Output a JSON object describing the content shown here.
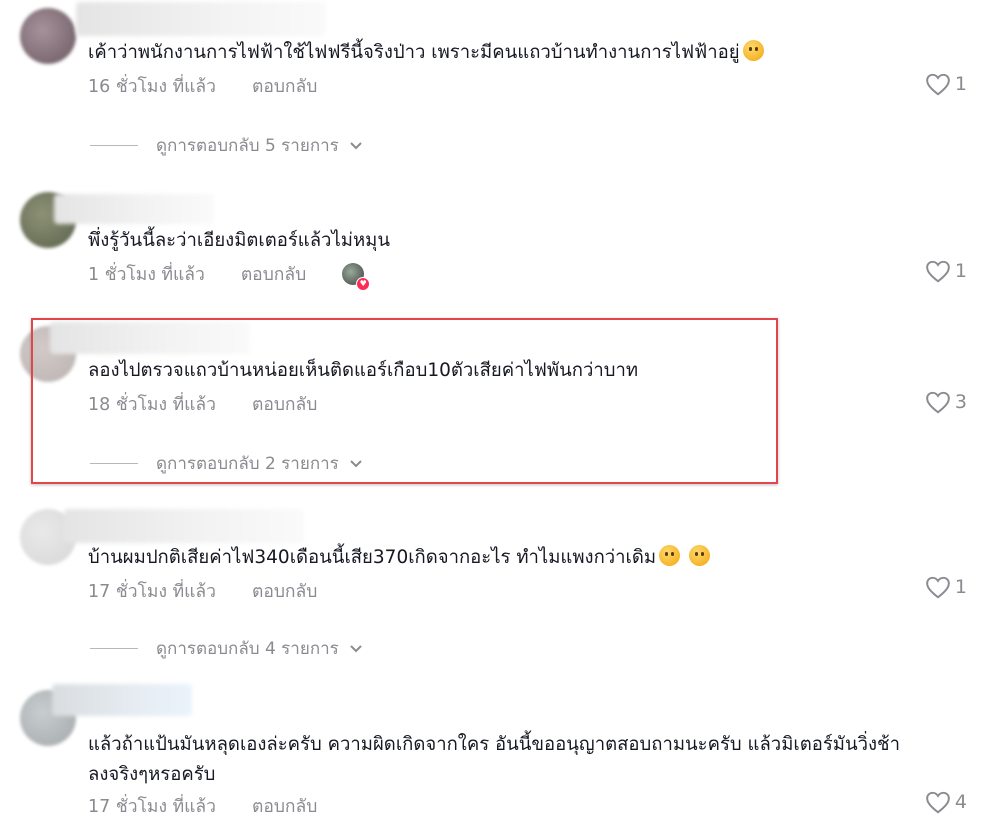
{
  "comments": [
    {
      "text": "เค้าว่าพนักงานการไฟฟ้าใช้ไฟฟรีนี้จริงป่าว เพราะมีคนแถวบ้านทำงานการไฟฟ้าอยู่",
      "time": "16 ชั่วโมง ที่แล้ว",
      "reply": "ตอบกลับ",
      "likes": "1",
      "view_replies": "ดูการตอบกลับ 5 รายการ",
      "emoji": "pleading-face-emoji"
    },
    {
      "text": "พึ่งรู้วันนี้ละว่าเอียงมิตเตอร์แล้วไม่หมุน",
      "time": "1 ชั่วโมง ที่แล้ว",
      "reply": "ตอบกลับ",
      "likes": "1",
      "creator_liked": true
    },
    {
      "text": "ลองไปตรวจแถวบ้านหน่อยเห็นติดแอร์เกือบ10ตัวเสียค่าไฟพันกว่าบาท",
      "time": "18 ชั่วโมง ที่แล้ว",
      "reply": "ตอบกลับ",
      "likes": "3",
      "view_replies": "ดูการตอบกลับ 2 รายการ",
      "highlighted": true
    },
    {
      "text": "บ้านผมปกติเสียค่าไฟ340เดือนนี้เสีย370เกิดจากอะไร ทำไมแพงกว่าเดิม",
      "time": "17 ชั่วโมง ที่แล้ว",
      "reply": "ตอบกลับ",
      "likes": "1",
      "view_replies": "ดูการตอบกลับ 4 รายการ",
      "emoji": "eye-roll-emoji, smirk-emoji"
    },
    {
      "text_line1": "แล้วถ้าแป้นมันหลุดเองล่ะครับ ความผิดเกิดจากใคร อันนี้ขออนุญาตสอบถามนะครับ แล้วมิเตอร์มันวิ่งช้า",
      "text_line2": "ลงจริงๆหรอครับ",
      "time": "17 ชั่วโมง ที่แล้ว",
      "reply": "ตอบกลับ",
      "likes": "4"
    }
  ],
  "colors": {
    "text": "#161823",
    "muted": "#8a8b91",
    "highlight_border": "#e0464b",
    "creator_like_badge": "#fe2c55"
  }
}
